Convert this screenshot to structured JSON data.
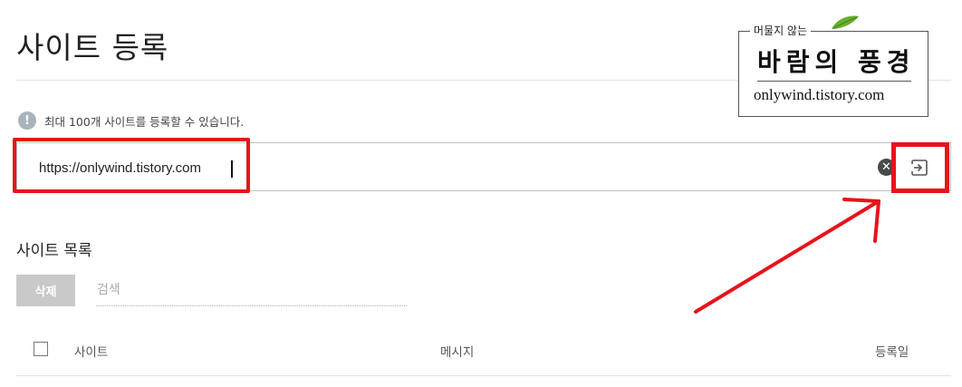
{
  "header": {
    "title": "사이트 등록"
  },
  "notice": {
    "icon": "info-icon",
    "text": "최대 100개 사이트를 등록할 수 있습니다."
  },
  "url_input": {
    "value": "https://onlywind.tistory.com",
    "clear_icon": "clear-icon",
    "submit_icon": "enter-icon"
  },
  "site_list": {
    "title": "사이트 목록",
    "delete_label": "삭제",
    "search_placeholder": "검색",
    "columns": [
      "사이트",
      "메시지",
      "등록일"
    ]
  },
  "watermark": {
    "subtitle": "머물지 않는",
    "title": "바람의 풍경",
    "url": "onlywind.tistory.com"
  },
  "colors": {
    "highlight": "#e8131b",
    "delete_button": "#c9c9c9",
    "notice_icon": "#a9b3bd"
  }
}
